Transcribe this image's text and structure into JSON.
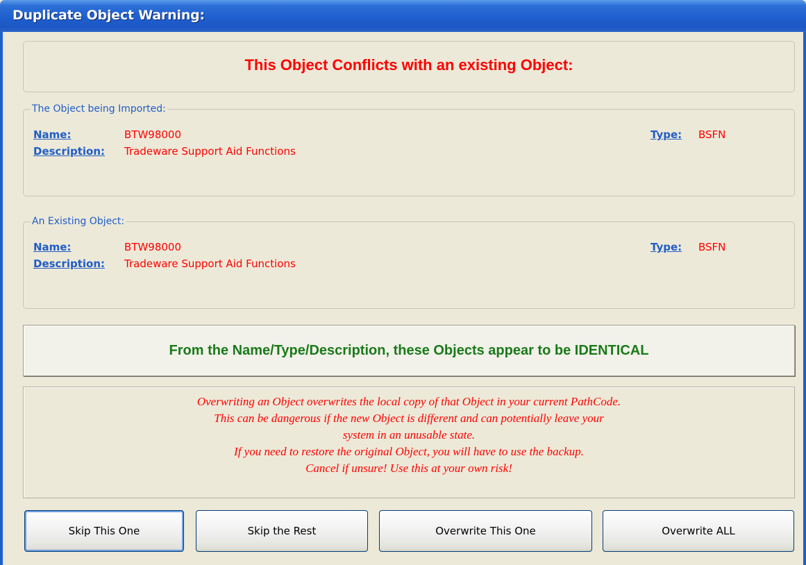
{
  "window": {
    "title": "Duplicate Object Warning:"
  },
  "header": {
    "message": "This Object Conflicts with an existing Object:"
  },
  "imported": {
    "legend": "The Object being Imported:",
    "name_label": "Name:",
    "name_value": "BTW98000",
    "type_label": "Type:",
    "type_value": "BSFN",
    "description_label": "Description:",
    "description_value": "Tradeware Support Aid Functions"
  },
  "existing": {
    "legend": "An Existing Object:",
    "name_label": "Name:",
    "name_value": "BTW98000",
    "type_label": "Type:",
    "type_value": "BSFN",
    "description_label": "Description:",
    "description_value": "Tradeware Support Aid Functions"
  },
  "comparison": {
    "message": "From the Name/Type/Description, these Objects appear to be IDENTICAL"
  },
  "warning": {
    "lines": [
      "Overwriting an Object overwrites the local copy of that Object in your current PathCode.",
      "This can be dangerous if the new Object is different and can potentially leave your",
      "system in an unusable state.",
      "If you need to restore the original Object, you will have to use the backup.",
      "Cancel if unsure! Use this at your own risk!"
    ]
  },
  "buttons": {
    "skip_this_one": "Skip This One",
    "skip_the_rest": "Skip the Rest",
    "overwrite_this_one": "Overwrite This One",
    "overwrite_all": "Overwrite ALL"
  },
  "colors": {
    "title_bar": "#1f5fcf",
    "label_blue": "#215dc6",
    "value_red": "#ff0000",
    "identical_green": "#1a7a1a"
  }
}
